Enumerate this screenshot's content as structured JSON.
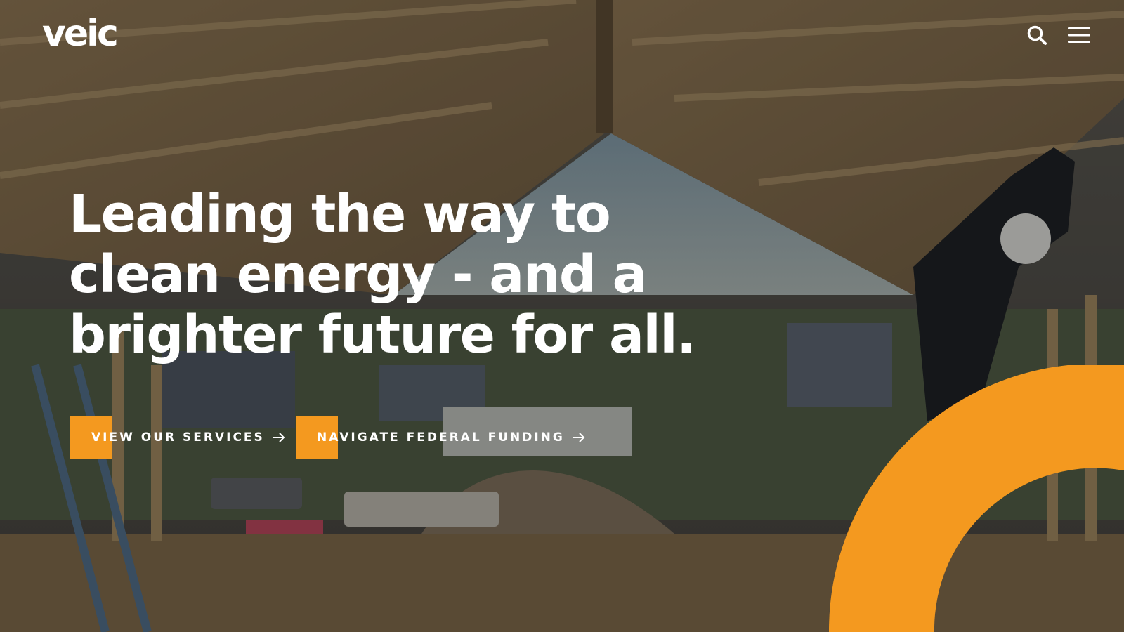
{
  "header": {
    "logo_text": "veic",
    "search_icon": "search-icon",
    "menu_icon": "hamburger-menu-icon"
  },
  "hero": {
    "headline_line1": "Leading the way to",
    "headline_line2": "clean energy - and a",
    "headline_line3": "brighter future for all.",
    "cta_primary_label": "VIEW OUR SERVICES",
    "cta_secondary_label": "NAVIGATE FEDERAL FUNDING",
    "cta_icon": "arrow-right-icon"
  },
  "colors": {
    "accent": "#f4991f",
    "text": "#ffffff"
  }
}
